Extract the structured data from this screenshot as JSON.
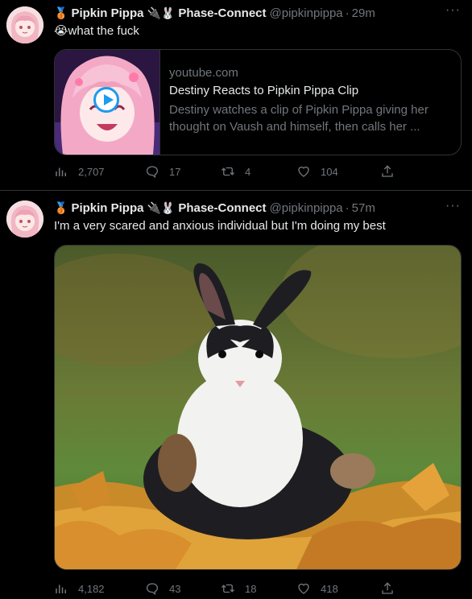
{
  "tweets": [
    {
      "badge_emoji": "🥉",
      "name": "Pipkin Pippa",
      "connector_emoji": "🔌🐰",
      "affiliation": "Phase-Connect",
      "handle": "@pipkinpippa",
      "separator": "·",
      "time": "29m",
      "caption_emoji": "😭",
      "caption": "what the fuck",
      "more": "···",
      "card": {
        "domain": "youtube.com",
        "title": "Destiny Reacts to Pipkin Pippa Clip",
        "description": "Destiny watches a clip of Pipkin Pippa giving her thought on Vaush and himself, then calls her ..."
      },
      "stats": {
        "views": "2,707",
        "replies": "17",
        "retweets": "4",
        "likes": "104"
      }
    },
    {
      "badge_emoji": "🥉",
      "name": "Pipkin Pippa",
      "connector_emoji": "🔌🐰",
      "affiliation": "Phase-Connect",
      "handle": "@pipkinpippa",
      "separator": "·",
      "time": "57m",
      "caption": "I'm a very scared and anxious individual but I'm doing my best",
      "more": "···",
      "stats": {
        "views": "4,182",
        "replies": "43",
        "retweets": "18",
        "likes": "418"
      }
    }
  ],
  "colors": {
    "background": "#000000",
    "text": "#e7e9ea",
    "muted": "#71767b",
    "border": "#2f3336",
    "accent": "#1d9bf0"
  },
  "icons": [
    "more-icon",
    "views-icon",
    "reply-icon",
    "retweet-icon",
    "like-icon",
    "share-icon",
    "play-icon"
  ]
}
